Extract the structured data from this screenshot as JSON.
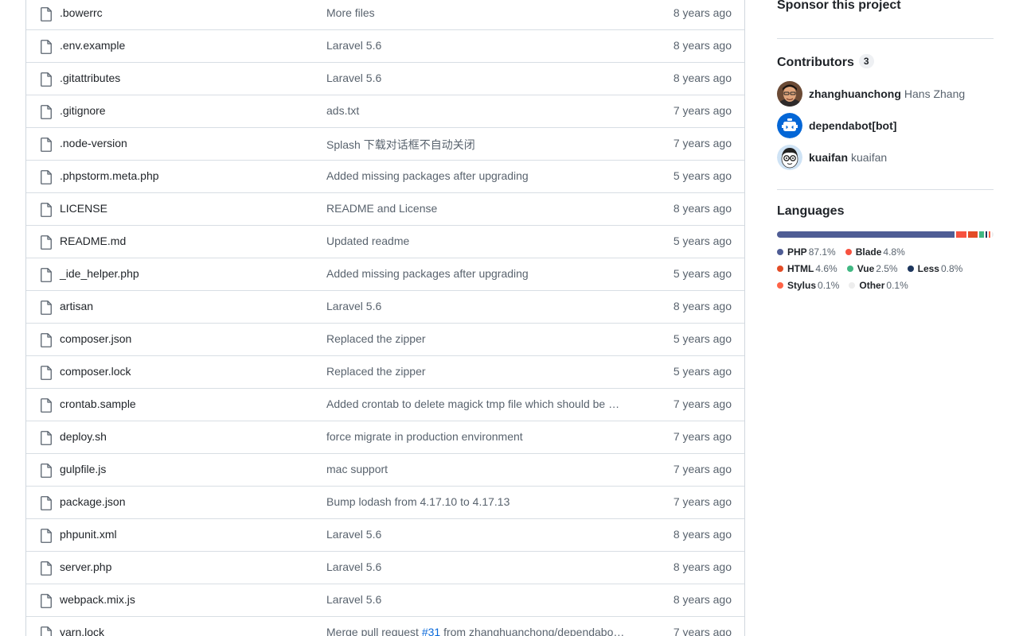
{
  "files": [
    {
      "name": ".bowerrc",
      "message": "More files",
      "time": "8 years ago"
    },
    {
      "name": ".env.example",
      "message": "Laravel 5.6",
      "time": "8 years ago"
    },
    {
      "name": ".gitattributes",
      "message": "Laravel 5.6",
      "time": "8 years ago"
    },
    {
      "name": ".gitignore",
      "message": "ads.txt",
      "time": "7 years ago"
    },
    {
      "name": ".node-version",
      "message": "Splash 下载对话框不自动关闭",
      "time": "7 years ago"
    },
    {
      "name": ".phpstorm.meta.php",
      "message": "Added missing packages after upgrading",
      "time": "5 years ago"
    },
    {
      "name": "LICENSE",
      "message": "README and License",
      "time": "8 years ago"
    },
    {
      "name": "README.md",
      "message": "Updated readme",
      "time": "5 years ago"
    },
    {
      "name": "_ide_helper.php",
      "message": "Added missing packages after upgrading",
      "time": "5 years ago"
    },
    {
      "name": "artisan",
      "message": "Laravel 5.6",
      "time": "8 years ago"
    },
    {
      "name": "composer.json",
      "message": "Replaced the zipper",
      "time": "5 years ago"
    },
    {
      "name": "composer.lock",
      "message": "Replaced the zipper",
      "time": "5 years ago"
    },
    {
      "name": "crontab.sample",
      "message": "Added crontab to delete magick tmp file which should be …",
      "time": "7 years ago"
    },
    {
      "name": "deploy.sh",
      "message": "force migrate in production environment",
      "time": "7 years ago"
    },
    {
      "name": "gulpfile.js",
      "message": "mac support",
      "time": "7 years ago"
    },
    {
      "name": "package.json",
      "message": "Bump lodash from 4.17.10 to 4.17.13",
      "time": "7 years ago"
    },
    {
      "name": "phpunit.xml",
      "message": "Laravel 5.6",
      "time": "8 years ago"
    },
    {
      "name": "server.php",
      "message": "Laravel 5.6",
      "time": "8 years ago"
    },
    {
      "name": "webpack.mix.js",
      "message": "Laravel 5.6",
      "time": "8 years ago"
    }
  ],
  "last_file": {
    "name": "yarn.lock",
    "message_prefix": "Merge pull request ",
    "message_link": "#31",
    "message_suffix": " from zhanghuanchong/dependabo…",
    "time": "7 years ago"
  },
  "sidebar": {
    "sponsor_title": "Sponsor this project",
    "contributors_title": "Contributors",
    "contributors_count": "3",
    "contributors": [
      {
        "login": "zhanghuanchong",
        "name": "Hans Zhang",
        "avatar_icon": "person-photo-avatar"
      },
      {
        "login": "dependabot[bot]",
        "name": "",
        "avatar_icon": "robot-avatar"
      },
      {
        "login": "kuaifan",
        "name": "kuaifan",
        "avatar_icon": "cartoon-glasses-avatar"
      }
    ],
    "languages_title": "Languages",
    "languages": [
      {
        "name": "PHP",
        "percent": "87.1%",
        "value": 87.1,
        "color": "#4F5D95"
      },
      {
        "name": "Blade",
        "percent": "4.8%",
        "value": 4.8,
        "color": "#f7523f"
      },
      {
        "name": "HTML",
        "percent": "4.6%",
        "value": 4.6,
        "color": "#e34c26"
      },
      {
        "name": "Vue",
        "percent": "2.5%",
        "value": 2.5,
        "color": "#41b883"
      },
      {
        "name": "Less",
        "percent": "0.8%",
        "value": 0.8,
        "color": "#1d365d"
      },
      {
        "name": "Stylus",
        "percent": "0.1%",
        "value": 0.1,
        "color": "#ff6347"
      },
      {
        "name": "Other",
        "percent": "0.1%",
        "value": 0.1,
        "color": "#ededed"
      }
    ]
  }
}
